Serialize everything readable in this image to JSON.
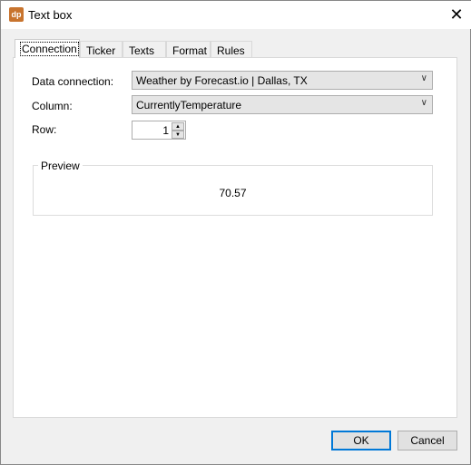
{
  "window": {
    "title": "Text box",
    "logo_text": "dp",
    "close_glyph": "✕"
  },
  "tabs": [
    {
      "label": "Connection"
    },
    {
      "label": "Ticker"
    },
    {
      "label": "Texts"
    },
    {
      "label": "Format"
    },
    {
      "label": "Rules"
    }
  ],
  "form": {
    "data_connection": {
      "label": "Data connection:",
      "value": "Weather by Forecast.io | Dallas, TX"
    },
    "column": {
      "label": "Column:",
      "value": "CurrentlyTemperature"
    },
    "row": {
      "label": "Row:",
      "value": "1"
    }
  },
  "preview": {
    "label": "Preview",
    "value": "70.57"
  },
  "buttons": {
    "ok": "OK",
    "cancel": "Cancel"
  }
}
